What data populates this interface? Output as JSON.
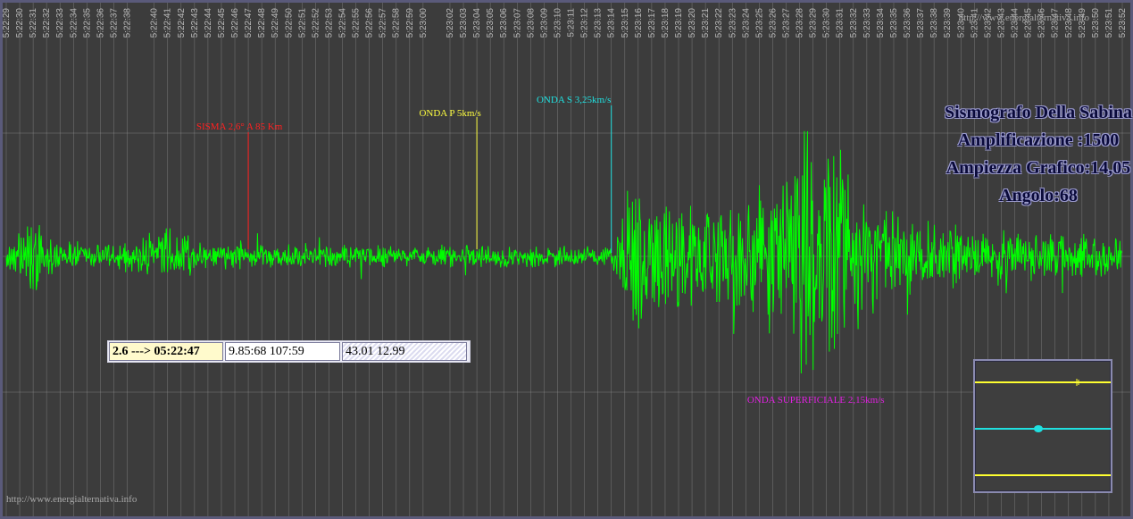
{
  "watermark_top": "http://www.energialternativa.info",
  "watermark_bottom": "http://www.energialternativa.info",
  "title": {
    "lines": [
      "Sismografo Della Sabina",
      "Amplificazione :1500",
      "Ampiezza Grafico:14,05",
      "Angolo:68"
    ]
  },
  "info_box": {
    "event": "2.6 ---> 05:22:47",
    "coords": "9.85:68 107:59",
    "location": "43.01 12.99"
  },
  "colors": {
    "trace": "#00ff00",
    "sisma": "#ff2020",
    "onda_p": "#ffff40",
    "onda_s": "#20e0e0",
    "onda_superficiale": "#e020e0",
    "grid": "#9a9a9a",
    "background": "#3c3c3c"
  },
  "chart_data": {
    "type": "line",
    "title": "Sismografo Della Sabina",
    "xlabel": "",
    "ylabel": "",
    "x_ticks": [
      "5:22:29",
      "5:22:30",
      "5:22:31",
      "5:22:32",
      "5:22:33",
      "5:22:34",
      "5:22:35",
      "5:22:36",
      "5:22:37",
      "5:22:38",
      "5:22:40",
      "5:22:41",
      "5:22:42",
      "5:22:43",
      "5:22:44",
      "5:22:45",
      "5:22:46",
      "5:22:47",
      "5:22:48",
      "5:22:49",
      "5:22:50",
      "5:22:51",
      "5:22:52",
      "5:22:53",
      "5:22:54",
      "5:22:55",
      "5:22:56",
      "5:22:57",
      "5:22:58",
      "5:22:59",
      "5:23:00",
      "5:23:02",
      "5:23:03",
      "5:23:04",
      "5:23:05",
      "5:23:06",
      "5:23:07",
      "5:23:08",
      "5:23:09",
      "5:23:10",
      "5:23:11",
      "5:23:12",
      "5:23:13",
      "5:23:14",
      "5:23:15",
      "5:23:16",
      "5:23:17",
      "5:23:18",
      "5:23:19",
      "5:23:20",
      "5:23:21",
      "5:23:22",
      "5:23:23",
      "5:23:24",
      "5:23:25",
      "5:23:26",
      "5:23:27",
      "5:23:28",
      "5:23:29",
      "5:23:30",
      "5:23:31",
      "5:23:32",
      "5:23:33",
      "5:23:34",
      "5:23:35",
      "5:23:36",
      "5:23:37",
      "5:23:38",
      "5:23:39",
      "5:23:40",
      "5:23:41",
      "5:23:42",
      "5:23:43",
      "5:23:44",
      "5:23:45",
      "5:23:46",
      "5:23:47",
      "5:23:48",
      "5:23:49",
      "5:23:50",
      "5:23:51",
      "5:23:52"
    ],
    "x_range": [
      "5:22:29",
      "5:23:52"
    ],
    "envelope": [
      {
        "t": "5:22:29",
        "amp": 0.09
      },
      {
        "t": "5:22:31",
        "amp": 0.35
      },
      {
        "t": "5:22:33",
        "amp": 0.09
      },
      {
        "t": "5:22:37",
        "amp": 0.1
      },
      {
        "t": "5:22:41",
        "amp": 0.2
      },
      {
        "t": "5:22:44",
        "amp": 0.1
      },
      {
        "t": "5:23:14",
        "amp": 0.08
      },
      {
        "t": "5:23:16",
        "amp": 0.65
      },
      {
        "t": "5:23:18",
        "amp": 0.45
      },
      {
        "t": "5:23:22",
        "amp": 0.35
      },
      {
        "t": "5:23:26",
        "amp": 0.6
      },
      {
        "t": "5:23:29",
        "amp": 1.0
      },
      {
        "t": "5:23:31",
        "amp": 0.8
      },
      {
        "t": "5:23:34",
        "amp": 0.35
      },
      {
        "t": "5:23:40",
        "amp": 0.22
      },
      {
        "t": "5:23:52",
        "amp": 0.15
      }
    ],
    "markers": [
      {
        "label": "SISMA 2,6° A 85 Km",
        "t": "5:22:47",
        "color": "#ff2020"
      },
      {
        "label": "ONDA P 5km/s",
        "t": "5:23:04",
        "color": "#ffff40"
      },
      {
        "label": "ONDA S 3,25km/s",
        "t": "5:23:14",
        "color": "#20e0e0"
      },
      {
        "label": "ONDA SUPERFICIALE 2,15km/s",
        "t": "5:23:30",
        "color": "#e020e0"
      }
    ],
    "grid": true
  }
}
